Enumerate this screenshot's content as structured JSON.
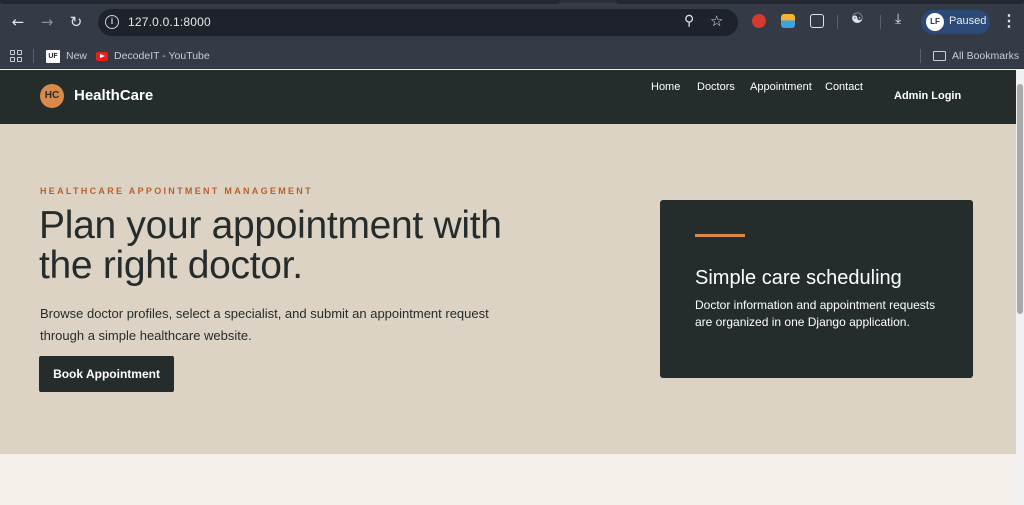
{
  "browser": {
    "url": "127.0.0.1:8000",
    "profile_status": "Paused",
    "profile_initials": "LF",
    "bookmarks": [
      {
        "label": "New",
        "icon": "new-favicon"
      },
      {
        "label": "DecodeIT - YouTube",
        "icon": "youtube-icon"
      }
    ],
    "all_bookmarks_label": "All Bookmarks"
  },
  "site": {
    "logo_initials": "HC",
    "brand": "HealthCare",
    "nav": [
      "Home",
      "Doctors",
      "Appointment",
      "Contact"
    ],
    "admin_login": "Admin Login"
  },
  "hero": {
    "eyebrow": "HEALTHCARE APPOINTMENT MANAGEMENT",
    "headline": "Plan your appointment with the right doctor.",
    "lead": "Browse doctor profiles, select a specialist, and submit an appointment request through a simple healthcare website.",
    "cta": "Book Appointment"
  },
  "card": {
    "title": "Simple care scheduling",
    "text": "Doctor information and appointment requests are organized in one Django application."
  },
  "colors": {
    "header_bg": "#252c2c",
    "hero_bg": "#ddd3c5",
    "accent": "#d9894a",
    "eyebrow": "#b4622f",
    "page_bg": "#f4efe8"
  }
}
